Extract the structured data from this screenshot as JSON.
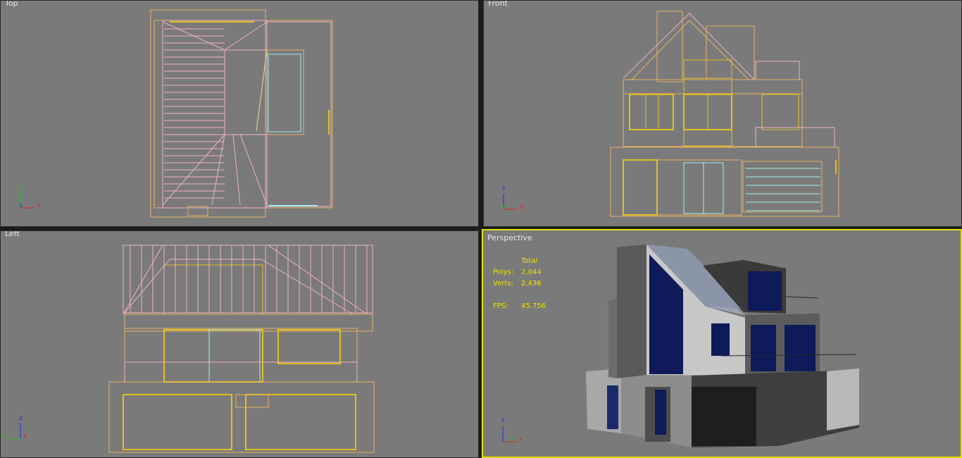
{
  "viewports": {
    "top": {
      "label": "Top"
    },
    "front": {
      "label": "Front"
    },
    "left": {
      "label": "Left"
    },
    "perspective": {
      "label": "Perspective"
    }
  },
  "stats": {
    "header": "Total",
    "polys_label": "Polys:",
    "polys_value": "2,044",
    "verts_label": "Verts:",
    "verts_value": "2,436",
    "fps_label": "FPS:",
    "fps_value": "45.756"
  },
  "axes": {
    "x": "x",
    "y": "y",
    "z": "z"
  },
  "colors": {
    "viewport_bg": "#7a7a7a",
    "active_border": "#e6e000",
    "wire_pink": "#f0b0c0",
    "wire_orange": "#e8b060",
    "wire_yellow": "#e0c020",
    "wire_cyan": "#a0f0f0",
    "stats_text": "#f0e000"
  }
}
